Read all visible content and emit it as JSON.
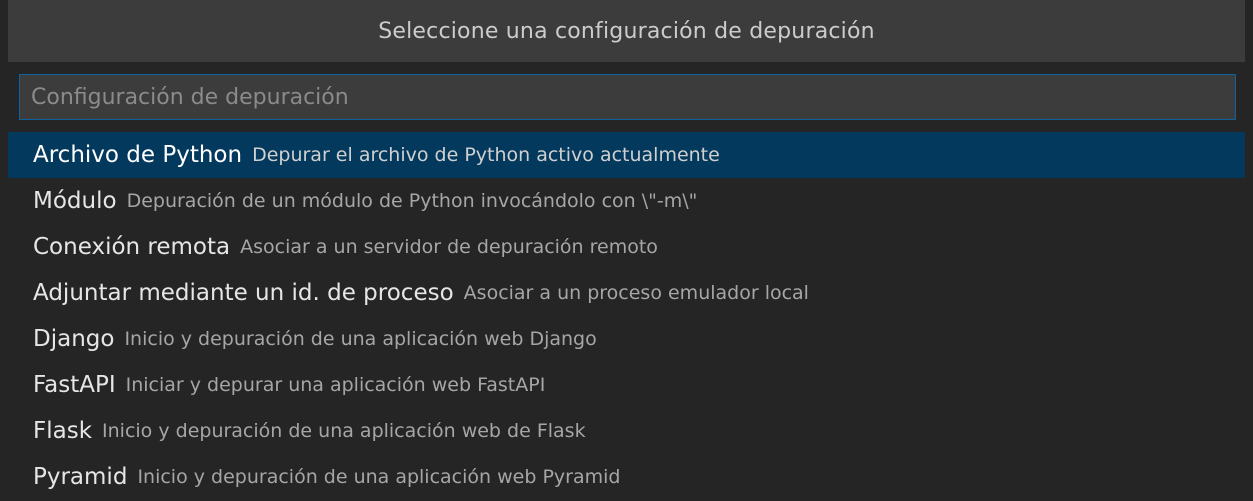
{
  "dialog": {
    "title": "Seleccione una configuración de depuración"
  },
  "search": {
    "placeholder": "Configuración de depuración",
    "value": ""
  },
  "items": [
    {
      "label": "Archivo de Python",
      "description": "Depurar el archivo de Python activo actualmente",
      "selected": true
    },
    {
      "label": "Módulo",
      "description": "Depuración de un módulo de Python invocándolo con \\\"-m\\\""
    },
    {
      "label": "Conexión remota",
      "description": "Asociar a un servidor de depuración remoto"
    },
    {
      "label": "Adjuntar mediante un id. de proceso",
      "description": "Asociar a un proceso emulador local"
    },
    {
      "label": "Django",
      "description": "Inicio y depuración de una aplicación web Django"
    },
    {
      "label": "FastAPI",
      "description": "Iniciar y depurar una aplicación web FastAPI"
    },
    {
      "label": "Flask",
      "description": "Inicio y depuración de una aplicación web de Flask"
    },
    {
      "label": "Pyramid",
      "description": "Inicio y depuración de una aplicación web Pyramid"
    }
  ],
  "colors": {
    "background": "#252526",
    "title_bar": "#3c3c3c",
    "input_border": "#0e639c",
    "selected_row": "#04395e"
  }
}
